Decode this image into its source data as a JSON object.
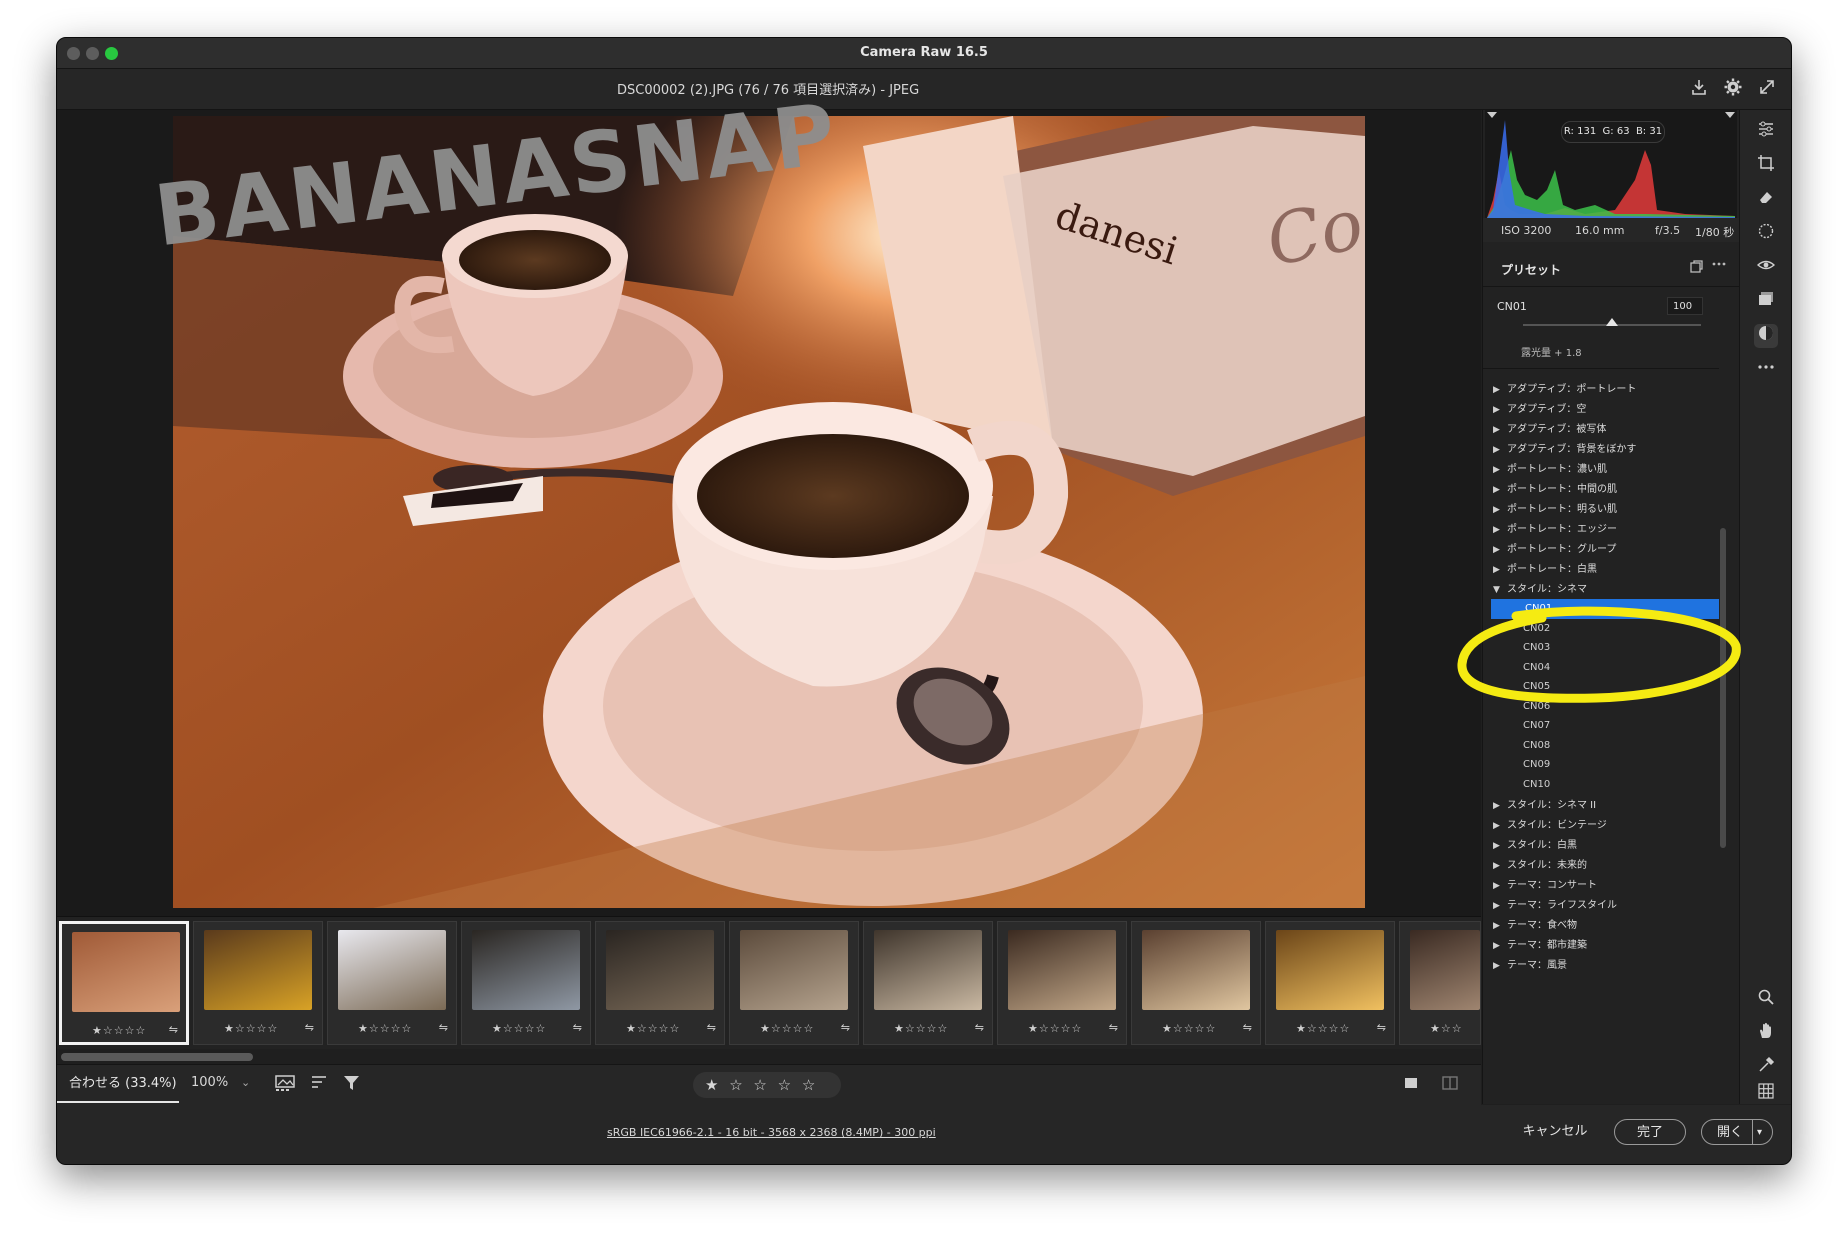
{
  "window": {
    "title": "Camera Raw 16.5"
  },
  "topbar": {
    "filename": "DSC00002 (2).JPG (76 / 76 項目選択済み)  -  JPEG"
  },
  "image": {
    "watermark": "BANANASNAP",
    "brand_text": "danesi",
    "sign_text": "Coca"
  },
  "filmstrip": {
    "thumbs": [
      {
        "stars": "★☆☆☆☆",
        "colors": [
          "#a05a37",
          "#d9a07a"
        ]
      },
      {
        "stars": "★☆☆☆☆",
        "colors": [
          "#5a3a1c",
          "#d8a226"
        ]
      },
      {
        "stars": "★☆☆☆☆",
        "colors": [
          "#e8e8ee",
          "#7b6a55"
        ]
      },
      {
        "stars": "★☆☆☆☆",
        "colors": [
          "#2a2622",
          "#8f98a4"
        ]
      },
      {
        "stars": "★☆☆☆☆",
        "colors": [
          "#2a2521",
          "#7a6a58"
        ]
      },
      {
        "stars": "★☆☆☆☆",
        "colors": [
          "#5c4b3c",
          "#b5a38e"
        ]
      },
      {
        "stars": "★☆☆☆☆",
        "colors": [
          "#3f352c",
          "#c9b8a2"
        ]
      },
      {
        "stars": "★☆☆☆☆",
        "colors": [
          "#3b2a20",
          "#c3a889"
        ]
      },
      {
        "stars": "★☆☆☆☆",
        "colors": [
          "#5a4030",
          "#e0c6a0"
        ]
      },
      {
        "stars": "★☆☆☆☆",
        "colors": [
          "#6b4518",
          "#f0c060"
        ]
      },
      {
        "stars": "★☆☆",
        "colors": [
          "#3a2a22",
          "#9f8570"
        ]
      }
    ],
    "sync_icon": "⇋"
  },
  "bottombar": {
    "fit_label": "合わせる (33.4%)",
    "zoom_label": "100%",
    "zoom_caret": "⌄",
    "rating": "★ ☆ ☆ ☆ ☆",
    "trash_icon": "🗑"
  },
  "footer": {
    "color_info": "sRGB IEC61966-2.1 - 16 bit - 3568 x 2368 (8.4MP) - 300 ppi",
    "cancel": "キャンセル",
    "done": "完了",
    "open": "開く"
  },
  "histogram": {
    "r": "R: 131",
    "g": "G: 63",
    "b": "B: 31"
  },
  "exif": {
    "iso": "ISO 3200",
    "focal": "16.0 mm",
    "aperture": "f/3.5",
    "shutter": "1/80 秒"
  },
  "presets": {
    "title": "プリセット",
    "amount_label": "CN01",
    "amount_value": "100",
    "amount_fraction": 0.5,
    "exposure": "露光量 + 1.8",
    "groups_top": [
      "アダプティブ：ポートレート",
      "アダプティブ：空",
      "アダプティブ：被写体",
      "アダプティブ：背景をぼかす",
      "ポートレート：濃い肌",
      "ポートレート：中間の肌",
      "ポートレート：明るい肌",
      "ポートレート：エッジー",
      "ポートレート：グループ",
      "ポートレート：白黒"
    ],
    "open_group": "スタイル：シネマ",
    "open_items": [
      "CN01",
      "CN02",
      "CN03",
      "CN04",
      "CN05",
      "CN06",
      "CN07",
      "CN08",
      "CN09",
      "CN10"
    ],
    "selected_item": "CN01",
    "groups_bottom": [
      "スタイル：シネマ II",
      "スタイル：ビンテージ",
      "スタイル：白黒",
      "スタイル：未来的",
      "テーマ：コンサート",
      "テーマ：ライフスタイル",
      "テーマ：食べ物",
      "テーマ：都市建築",
      "テーマ：風景"
    ]
  },
  "colors": {
    "accent": "#1f73e0",
    "annotation": "#f5eb12",
    "histogram_red": "#e33b3b",
    "histogram_green": "#3cc24a",
    "histogram_blue": "#3a6df0"
  },
  "icons": {
    "topbar": [
      "save-icon",
      "settings-gear-icon",
      "fullscreen-icon"
    ],
    "rail": [
      "edit-sliders-icon",
      "crop-icon",
      "heal-eraser-icon",
      "mask-icon",
      "red-eye-icon",
      "snapshots-icon",
      "presets-icon",
      "more-icon",
      "zoom-icon",
      "hand-icon",
      "color-sampler-icon",
      "grid-icon"
    ]
  }
}
